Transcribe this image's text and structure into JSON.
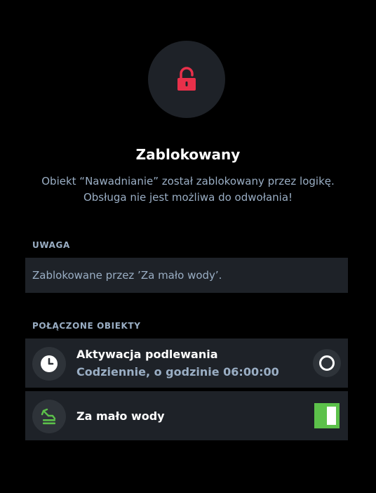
{
  "header": {
    "icon": "lock-icon",
    "icon_color": "#e8304a",
    "title": "Zablokowany",
    "description_line1": "Obiekt “Nawadnianie” został zablokowany przez logikę.",
    "description_line2": "Obsługa nie jest możliwa do odwołania!"
  },
  "note": {
    "label": "UWAGA",
    "text": "Zablokowane przez ’Za mało wody’."
  },
  "connected": {
    "label": "POŁĄCZONE OBIEKTY",
    "items": [
      {
        "icon": "clock-icon",
        "title": "Aktywacja podlewania",
        "subtitle": "Codziennie, o godzinie 06:00:00",
        "control": "circle-button"
      },
      {
        "icon": "water-level-icon",
        "title": "Za mało wody",
        "control": "toggle",
        "state": "on"
      }
    ]
  },
  "colors": {
    "background": "#000000",
    "panel": "#1e2228",
    "muted_text": "#9aaec4",
    "accent_green": "#5cc14a",
    "lock_red": "#e8304a"
  }
}
